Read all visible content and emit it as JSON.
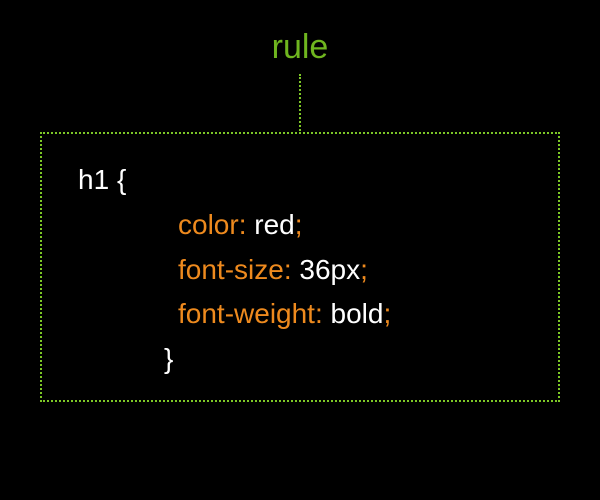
{
  "title": "rule",
  "code": {
    "selector": "h1",
    "open_brace": "{",
    "decl1": {
      "prop": "color",
      "colon": ":",
      "space": " ",
      "val": "red",
      "semi": ";"
    },
    "decl2": {
      "prop": "font-size",
      "colon": ":",
      "space": " ",
      "val": "36px",
      "semi": ";"
    },
    "decl3": {
      "prop": "font-weight",
      "colon": ":",
      "space": " ",
      "val": "bold",
      "semi": ";"
    },
    "close_brace": "}"
  }
}
